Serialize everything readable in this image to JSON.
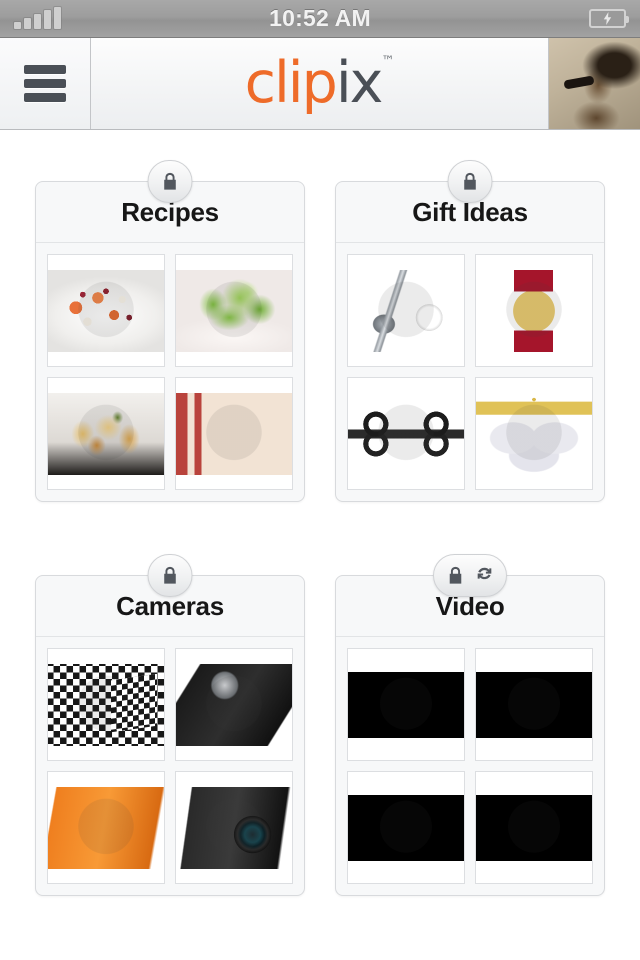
{
  "status_bar": {
    "time": "10:52 AM",
    "signal_icon": "signal-bars-icon",
    "signal_bars": 5,
    "battery_icon": "battery-charging-icon",
    "battery_state": "charging"
  },
  "header": {
    "menu_icon": "hamburger-menu-icon",
    "logo": {
      "primary": "clip",
      "secondary": "ix",
      "trademark": "™"
    },
    "avatar_label": "user-profile-photo"
  },
  "colors": {
    "brand_orange": "#ee6b29",
    "brand_dark": "#4a4f56",
    "page_background": "#ffffff",
    "card_background": "#f7f8f9",
    "card_border": "#d8dadd",
    "status_bar": "#9d9d9d"
  },
  "clips": [
    {
      "title": "Recipes",
      "badges": [
        "lock-icon"
      ],
      "thumbs": [
        {
          "name": "fruit-salad-bowl",
          "style": "p-fruitsalad",
          "kind": "photo"
        },
        {
          "name": "green-salad-plate",
          "style": "p-salad",
          "kind": "photo"
        },
        {
          "name": "roasted-potatoes-pan",
          "style": "p-roast",
          "kind": "photo"
        },
        {
          "name": "cookbook-cutting-board",
          "style": "p-cutting",
          "kind": "photo"
        }
      ]
    },
    {
      "title": "Gift Ideas",
      "badges": [
        "lock-icon"
      ],
      "thumbs": [
        {
          "name": "golf-club-and-ball",
          "style": "p-golf",
          "kind": "photo"
        },
        {
          "name": "red-strap-heart-watch",
          "style": "p-watch",
          "kind": "photo"
        },
        {
          "name": "quadcopter-drone-with-phone",
          "style": "p-drone",
          "kind": "photo"
        },
        {
          "name": "mom-heart-necklace",
          "style": "p-necklace",
          "kind": "photo"
        }
      ]
    },
    {
      "title": "Cameras",
      "badges": [
        "lock-icon"
      ],
      "thumbs": [
        {
          "name": "checkered-pinhole-camera",
          "style": "p-pinhole",
          "kind": "photo"
        },
        {
          "name": "red-cinema-camera",
          "style": "p-red",
          "kind": "photo"
        },
        {
          "name": "orange-exilim-compact-camera",
          "style": "p-exilim",
          "kind": "photo"
        },
        {
          "name": "black-lumix-bridge-camera",
          "style": "p-lumix",
          "kind": "photo"
        }
      ]
    },
    {
      "title": "Video",
      "badges": [
        "lock-icon",
        "sync-icon"
      ],
      "thumbs": [
        {
          "name": "stage-performance-video",
          "style": "p-stage",
          "kind": "video"
        },
        {
          "name": "black-white-singer-video",
          "style": "p-singer-bw",
          "kind": "video"
        },
        {
          "name": "live-singer-video",
          "style": "p-singer-live",
          "kind": "video"
        },
        {
          "name": "food-animation-video",
          "style": "p-animation",
          "kind": "video"
        }
      ]
    }
  ]
}
